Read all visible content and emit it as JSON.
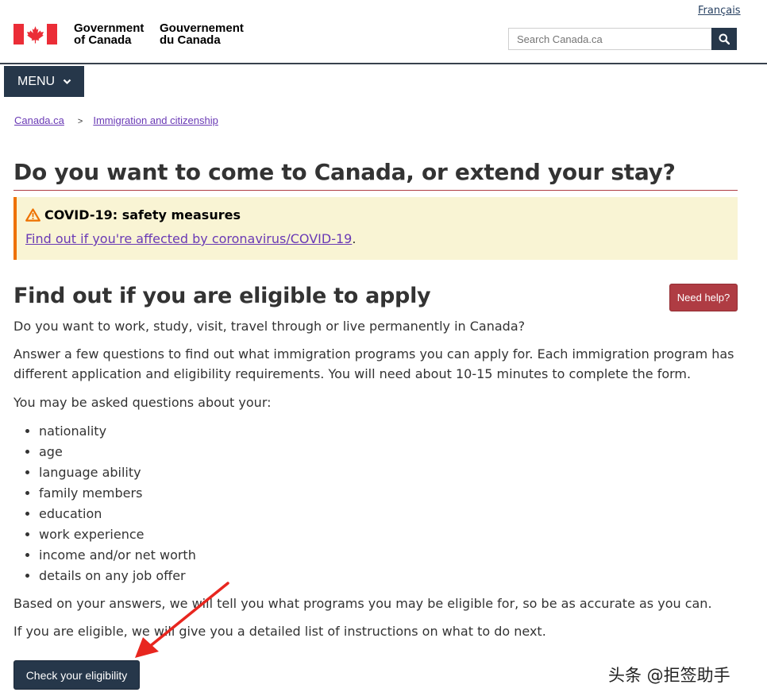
{
  "header": {
    "lang_link": "Français",
    "gov_en": [
      "Government",
      "of Canada"
    ],
    "gov_fr": [
      "Gouvernement",
      "du Canada"
    ],
    "search_placeholder": "Search Canada.ca",
    "search_icon": "search-icon"
  },
  "menu": {
    "label": "MENU",
    "icon": "chevron-down-icon"
  },
  "breadcrumb": {
    "items": [
      "Canada.ca",
      "Immigration and citizenship"
    ],
    "separator": ">"
  },
  "page": {
    "title": "Do you want to come to Canada, or extend your stay?"
  },
  "alert": {
    "icon": "warning-icon",
    "title": "COVID-19: safety measures",
    "link_text": "Find out if you're affected by coronavirus/COVID-19",
    "link_suffix": "."
  },
  "section": {
    "heading": "Find out if you are eligible to apply",
    "need_help": "Need help?",
    "intro": "Do you want to work, study, visit, travel through or live permanently in Canada?",
    "answer_line1": "Answer a few questions to find out what immigration programs you can apply for. Each immigration program has",
    "answer_line2": "different application and eligibility requirements. You will need about 10-15 minutes to complete the form.",
    "asked": "You may be asked questions about your:",
    "topics": [
      "nationality",
      "age",
      "language ability",
      "family members",
      "education",
      "work experience",
      "income and/or net worth",
      "details on any job offer"
    ],
    "based": "Based on your answers, we will tell you what programs you may be eligible for, so be as accurate as you can.",
    "eligible": "If you are eligible, we will give you a detailed list of instructions on what to do next.",
    "check_button": "Check your eligibility"
  },
  "watermark": "头条 @拒签助手",
  "colors": {
    "navy": "#26374a",
    "link": "#6a3ab5",
    "alert_bg": "#f9f4d4",
    "alert_border": "#ee7100",
    "danger": "#af3c43",
    "flag_red": "#eb2d37",
    "arrow_red": "#e8261f"
  }
}
